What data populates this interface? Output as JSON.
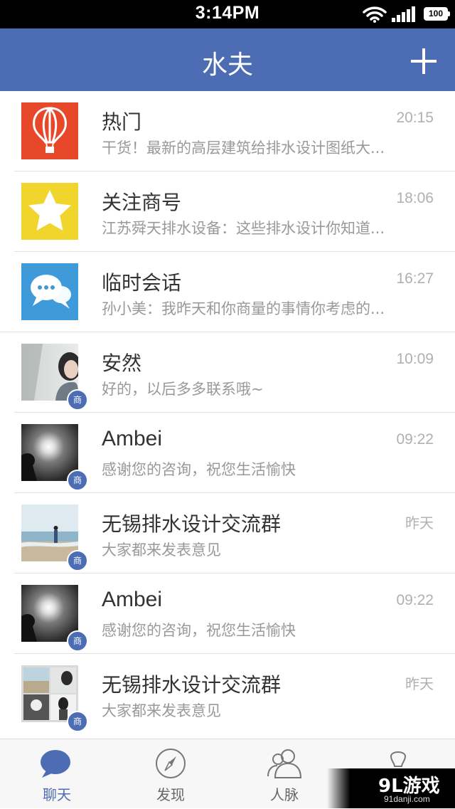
{
  "status_bar": {
    "time": "3:14PM",
    "battery": "100"
  },
  "header": {
    "title": "水夫",
    "add_icon": "plus-icon"
  },
  "chats": [
    {
      "name": "热门",
      "preview": "干货！最新的高层建筑给排水设计图纸大...",
      "time": "20:15",
      "avatar": "hot-air-balloon-icon",
      "avatar_color": "#e8482a"
    },
    {
      "name": "关注商号",
      "preview": "江苏舜天排水设备：这些排水设计你知道...",
      "time": "18:06",
      "avatar": "star-icon",
      "avatar_color": "#f0d52d"
    },
    {
      "name": "临时会话",
      "preview": "孙小美：我昨天和你商量的事情你考虑的...",
      "time": "16:27",
      "avatar": "chat-bubbles-icon",
      "avatar_color": "#3e9ad9"
    },
    {
      "name": "安然",
      "preview": "好的，以后多多联系哦~",
      "time": "10:09",
      "avatar": "photo-girl",
      "badge": "商"
    },
    {
      "name": "Ambei",
      "preview": "感谢您的咨询，祝您生活愉快",
      "time": "09:22",
      "avatar": "photo-silhouette",
      "badge": "商"
    },
    {
      "name": "无锡排水设计交流群",
      "preview": "大家都来发表意见",
      "time": "昨天",
      "avatar": "photo-beach",
      "badge": "商"
    },
    {
      "name": "Ambei",
      "preview": "感谢您的咨询，祝您生活愉快",
      "time": "09:22",
      "avatar": "photo-silhouette",
      "badge": "商"
    },
    {
      "name": "无锡排水设计交流群",
      "preview": "大家都来发表意见",
      "time": "昨天",
      "avatar": "photo-group-grid",
      "badge": "商"
    }
  ],
  "tabs": [
    {
      "label": "聊天",
      "icon": "chat-bubble-icon",
      "active": true
    },
    {
      "label": "发现",
      "icon": "compass-icon"
    },
    {
      "label": "人脉",
      "icon": "contacts-icon"
    },
    {
      "label": "",
      "icon": "profile-icon"
    }
  ],
  "watermark": {
    "logo": "9L游戏",
    "url": "91danji.com"
  },
  "colors": {
    "primary": "#4c6cb4",
    "divider": "#e3e3e3",
    "text": "#333333",
    "secondary_text": "#999999"
  }
}
